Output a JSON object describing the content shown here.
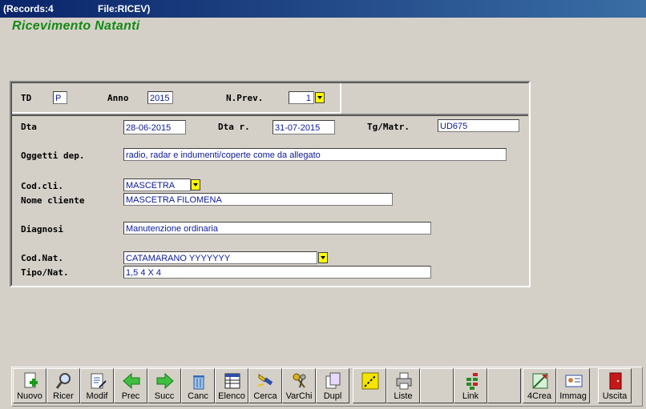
{
  "window": {
    "records": "(Records:4",
    "file": "File:RICEV)"
  },
  "app_title": "Ricevimento Natanti",
  "header": {
    "td_label": "TD",
    "td_value": "P",
    "anno_label": "Anno",
    "anno_value": "2015",
    "nprev_label": "N.Prev.",
    "nprev_value": "1"
  },
  "form": {
    "dta_label": "Dta",
    "dta_value": "28-06-2015",
    "dtar_label": "Dta r.",
    "dtar_value": "31-07-2015",
    "tg_label": "Tg/Matr.",
    "tg_value": "UD675",
    "oggetti_label": "Oggetti dep.",
    "oggetti_value": "radio, radar e indumenti/coperte come da allegato",
    "codcli_label": "Cod.cli.",
    "codcli_value": "MASCETRA",
    "nome_label": "Nome cliente",
    "nome_value": "MASCETRA FILOMENA",
    "diagnosi_label": "Diagnosi",
    "diagnosi_value": "Manutenzione ordinaria",
    "codnat_label": "Cod.Nat.",
    "codnat_value": "CATAMARANO YYYYYYY",
    "tipo_label": "Tipo/Nat.",
    "tipo_value": "1,5   4 X 4"
  },
  "toolbar": [
    "Nuovo",
    "Ricer",
    "Modif",
    "Prec",
    "Succ",
    "Canc",
    "Elenco",
    "Cerca",
    "VarChi",
    "Dupl",
    "",
    "Liste",
    "",
    "Link",
    "",
    "4Crea",
    "Immag",
    "Uscita"
  ],
  "colors": {
    "accent_title": "#138a13",
    "field_text": "#0b1a9a",
    "dropdown": "#ffff00"
  }
}
